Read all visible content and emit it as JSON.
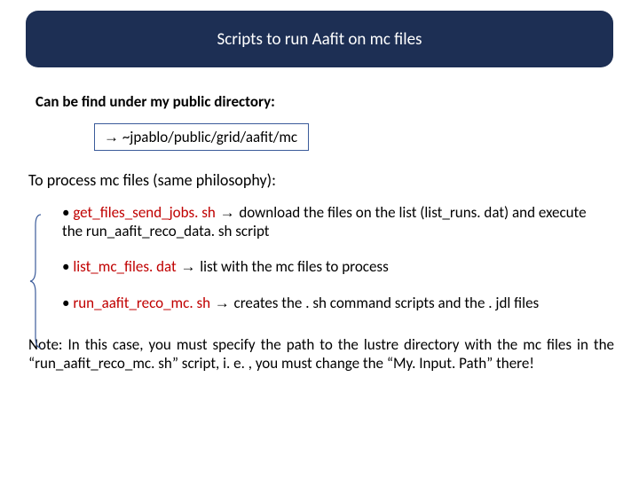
{
  "title": "Scripts to run Aafit on mc files",
  "sub1": "Can be find under my public directory:",
  "path_arrow": "→",
  "path": " ~jpablo/public/grid/aafit/mc",
  "process_line": "To process mc files (same philosophy):",
  "bullets": [
    {
      "marker": "•",
      "name": "get_files_send_jobs. sh",
      "arrow": " → ",
      "rest": "download the files on the list (list_runs. dat) and execute the run_aafit_reco_data. sh script"
    },
    {
      "marker": "•",
      "name": "list_mc_files. dat",
      "arrow": " → ",
      "rest": "list with the mc files to process"
    },
    {
      "marker": "•",
      "name": "run_aafit_reco_mc. sh",
      "arrow": " → ",
      "rest": "creates the . sh command scripts and the . jdl files"
    }
  ],
  "note": "Note: In this case, you must specify the path to the lustre directory with the mc files in the “run_aafit_reco_mc. sh” script, i. e. , you must change the “My. Input. Path” there!"
}
